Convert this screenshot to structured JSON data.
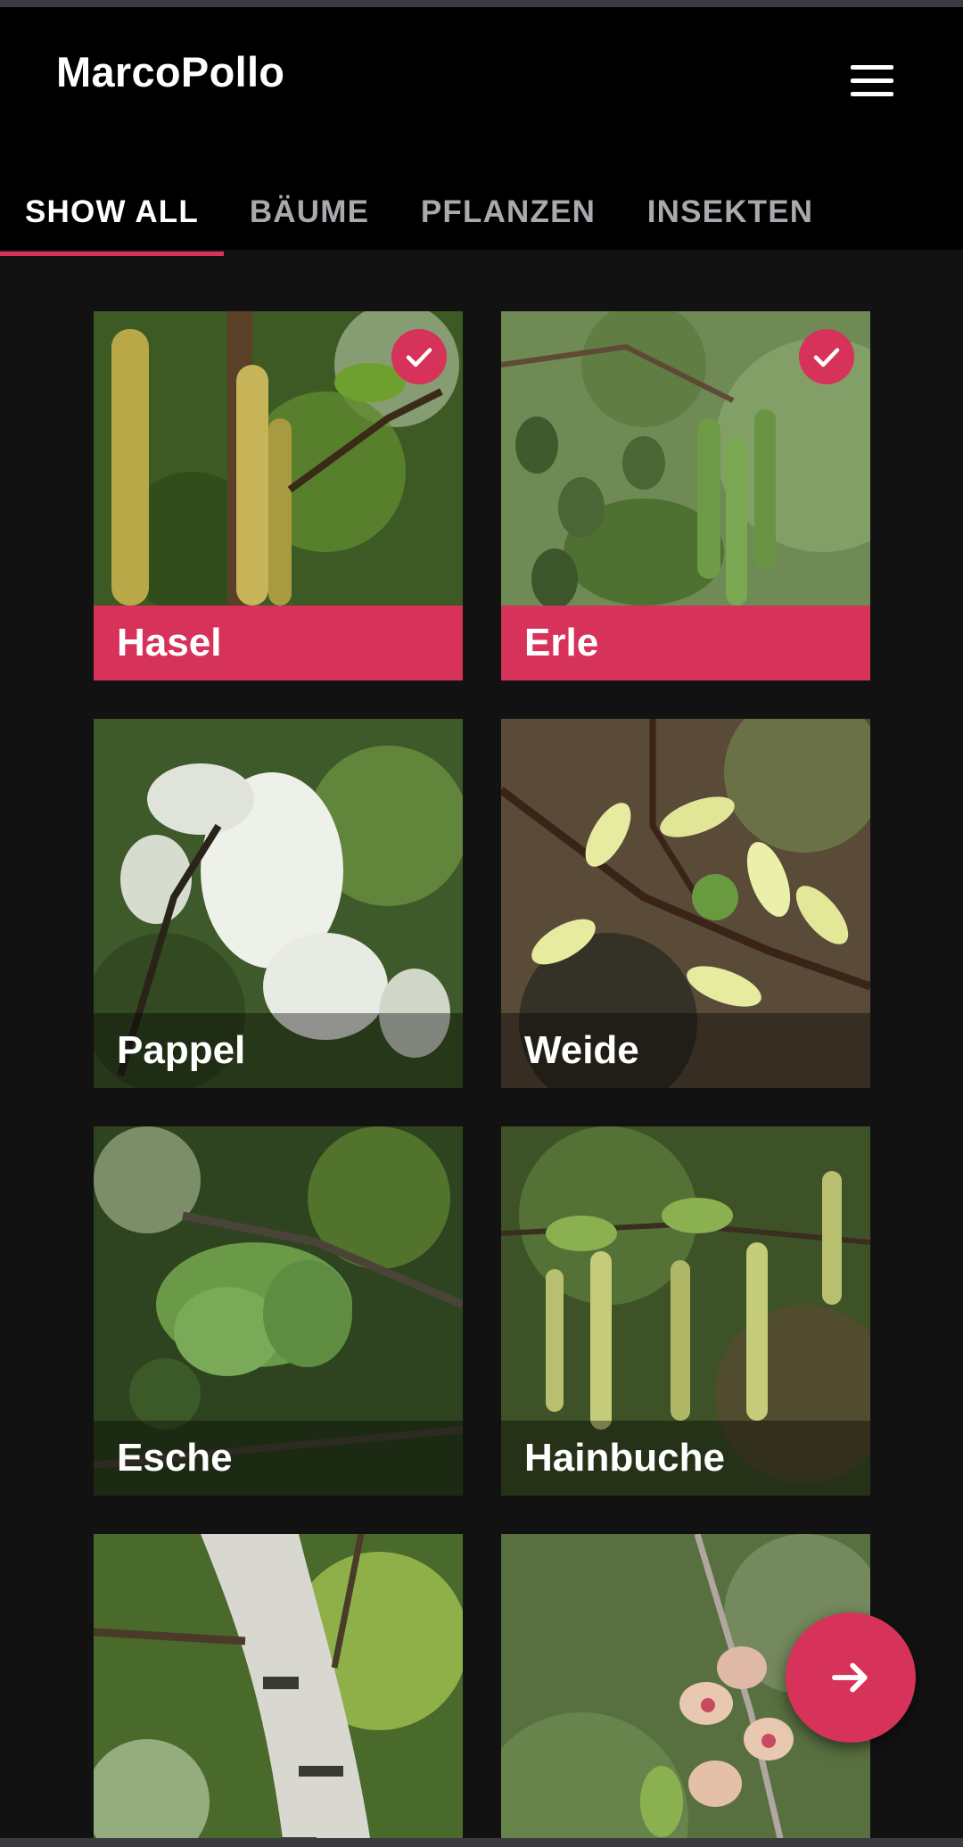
{
  "app": {
    "title": "MarcoPollo"
  },
  "tabs": [
    {
      "label": "SHOW ALL",
      "active": true
    },
    {
      "label": "BÄUME",
      "active": false
    },
    {
      "label": "PFLANZEN",
      "active": false
    },
    {
      "label": "INSEKTEN",
      "active": false
    }
  ],
  "cards": [
    {
      "name": "Hasel",
      "selected": true
    },
    {
      "name": "Erle",
      "selected": true
    },
    {
      "name": "Pappel",
      "selected": false
    },
    {
      "name": "Weide",
      "selected": false
    },
    {
      "name": "Esche",
      "selected": false
    },
    {
      "name": "Hainbuche",
      "selected": false
    },
    {
      "name": "",
      "selected": false
    },
    {
      "name": "",
      "selected": false
    }
  ],
  "icons": {
    "menu": "hamburger-menu-icon",
    "check": "check-icon",
    "fab": "arrow-right-icon"
  },
  "colors": {
    "accent": "#d6325a",
    "appbar": "#000000",
    "background": "#121212"
  }
}
